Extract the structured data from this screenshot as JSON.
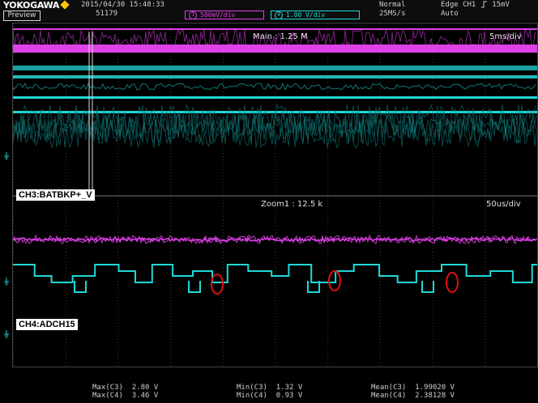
{
  "header": {
    "brand": "YOKOGAWA",
    "mode_badge": "Preview",
    "timestamp": "2015/04/30  15:48:33",
    "acq_count": "51179",
    "ch3_scale": "500mV/div",
    "ch4_scale": "1.00 V/div",
    "ch3_num": "3",
    "ch4_num": "4",
    "trigger_mode": "Normal",
    "sample_rate": "25MS/s",
    "trigger_source": "Edge CH1",
    "trigger_level": "15mV",
    "trigger_run": "Auto"
  },
  "main_window": {
    "record_label": "Main : 1.25 M",
    "timebase": "5ms/div"
  },
  "zoom_window": {
    "record_label": "Zoom1 : 12.5 k",
    "timebase": "50us/div"
  },
  "annotations": {
    "ch3_label": "CH3:BATBKP+_V",
    "ch4_label": "CH4:ADCH15"
  },
  "measurements": {
    "max_c3": "Max(C3)  2.80 V",
    "max_c4": "Max(C4)  3.46 V",
    "min_c3": "Min(C3)  1.32 V",
    "min_c4": "Min(C4)  0.93 V",
    "mean_c3": "Mean(C3)  1.99020 V",
    "mean_c4": "Mean(C4)  2.38128 V"
  },
  "colors": {
    "ch3": "#e040e8",
    "ch4": "#20d8d8",
    "marker": "#e01010"
  },
  "icons": [
    "yokogawa-diamond-icon",
    "trigger-edge-icon",
    "ground-marker-icon"
  ]
}
